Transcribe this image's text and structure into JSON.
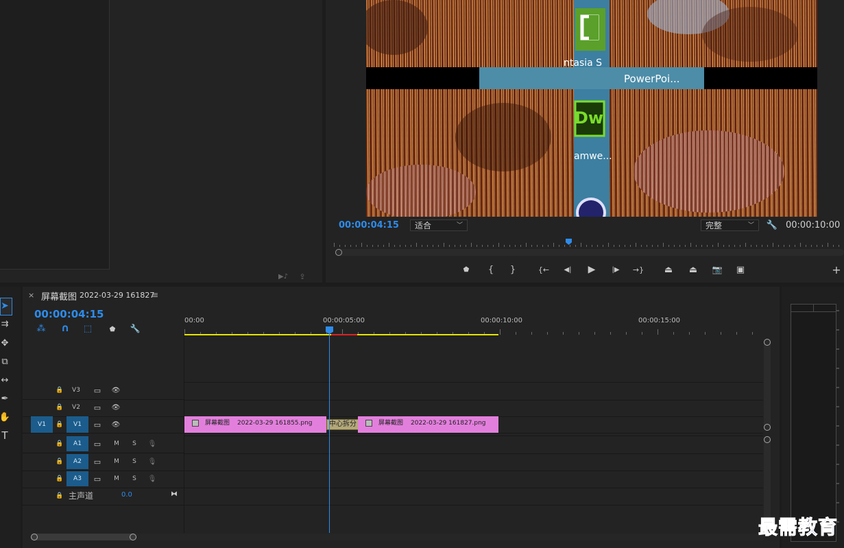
{
  "source_monitor": {
    "controls": [
      "volume-icon",
      "export-icon"
    ]
  },
  "program_monitor": {
    "preview": {
      "icon_label_camtasia": "ntasia S",
      "icon_label_powerpoint": "PowerPoi...",
      "icon_label_dreamweaver": "amwe...",
      "dw_icon_text": "Dw"
    },
    "current_time": "00:00:04:15",
    "fit_select": "适合",
    "quality_select": "完整",
    "duration": "00:00:10:00",
    "playhead_fraction": 0.45,
    "transport_glyphs": {
      "add_marker": "⬟",
      "mark_in": "{",
      "mark_out": "}",
      "go_to_in": "{←",
      "step_back": "◀|",
      "play": "▶",
      "step_forward": "|▶",
      "go_to_out": "→}",
      "lift": "⏏",
      "extract": "⏏",
      "export_frame": "📷",
      "compare": "▣",
      "add_button": "+"
    }
  },
  "tools": {
    "glyphs": [
      "➤",
      "⇉",
      "✥",
      "⧉",
      "↔",
      "✒",
      "✋",
      "T"
    ]
  },
  "timeline": {
    "close_glyph": "×",
    "sequence_name": "屏幕截图",
    "sequence_suffix": "2022-03-29 161827",
    "menu_glyph": "≡",
    "current_time": "00:00:04:15",
    "ruler": [
      "00:00",
      "00:00:05:00",
      "00:00:10:00",
      "00:00:15:00"
    ],
    "tool_glyphs": {
      "nest": "⁂",
      "snap": "∩",
      "linked": "⬚",
      "marker": "⬟",
      "settings": "🔧"
    },
    "video_tracks": [
      {
        "name": "V3"
      },
      {
        "name": "V2"
      },
      {
        "name": "V1",
        "source": "V1"
      }
    ],
    "audio_tracks": [
      {
        "name": "A1",
        "m": "M",
        "s": "S"
      },
      {
        "name": "A2",
        "m": "M",
        "s": "S"
      },
      {
        "name": "A3",
        "m": "M",
        "s": "S"
      }
    ],
    "master": {
      "label": "主声道",
      "value": "0.0"
    },
    "clips": [
      {
        "name": "屏幕截图",
        "suffix": "2022-03-29  161855.png"
      },
      {
        "name": "屏幕截图",
        "suffix": "2022-03-29  161827.png"
      }
    ],
    "transition": "中心拆分",
    "track_glyphs": {
      "lock": "🔒",
      "toggle": "▭",
      "eye": "👁",
      "mic": "🎙"
    }
  },
  "watermark": "最需教育",
  "colors": {
    "accent_blue": "#2d8ceb",
    "clip_pink": "#e27fdc",
    "track_blue": "#1b5c8c",
    "work_area_yellow": "#e5e500"
  }
}
